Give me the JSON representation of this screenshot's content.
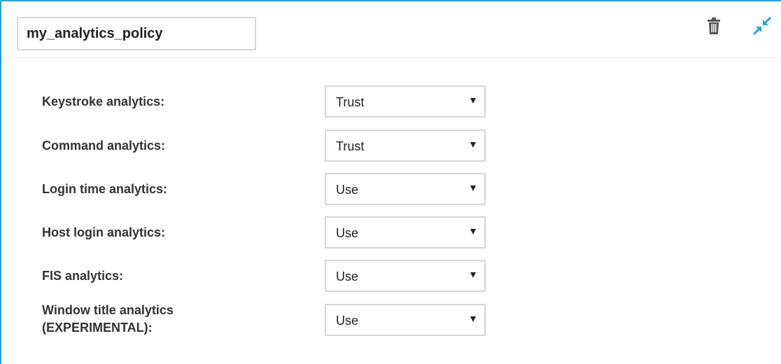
{
  "policy": {
    "name_value": "my_analytics_policy"
  },
  "header_icons": {
    "delete": "trash-icon",
    "collapse": "collapse-icon",
    "accent_color": "#2aa0d8"
  },
  "settings": [
    {
      "label": "Keystroke analytics:",
      "value": "Trust"
    },
    {
      "label": "Command analytics:",
      "value": "Trust"
    },
    {
      "label": "Login time analytics:",
      "value": "Use"
    },
    {
      "label": "Host login analytics:",
      "value": "Use"
    },
    {
      "label": "FIS analytics:",
      "value": "Use"
    },
    {
      "label_line1": "Window title analytics",
      "label_line2": "(EXPERIMENTAL):",
      "value": "Use"
    }
  ]
}
